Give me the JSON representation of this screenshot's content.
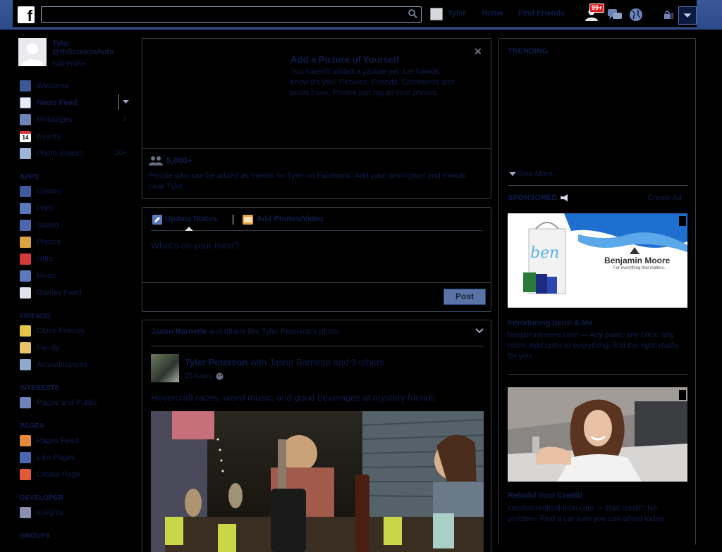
{
  "topbar": {
    "search_placeholder": "",
    "user_link": "Tyler",
    "home_link": "Home",
    "find_friends_link": "Find Friends",
    "notification_count": "99+"
  },
  "profile": {
    "name": "Tyler @fbScreenshots",
    "edit": "Edit Profile"
  },
  "nav": {
    "main": [
      {
        "label": "Welcome",
        "icon": "facebook-icon",
        "count": ""
      },
      {
        "label": "News Feed",
        "icon": "news-feed-icon",
        "count": ""
      },
      {
        "label": "Messages",
        "icon": "messages-icon",
        "count": "1"
      },
      {
        "label": "Events",
        "icon": "calendar-icon",
        "count": ""
      },
      {
        "label": "Photo Search",
        "icon": "photo-search-icon",
        "count": "20+"
      }
    ],
    "apps_heading": "APPS",
    "apps": [
      {
        "label": "Games",
        "icon": "games-icon"
      },
      {
        "label": "Polls",
        "icon": "polls-icon"
      },
      {
        "label": "Saved",
        "icon": "saved-icon"
      },
      {
        "label": "Photos",
        "icon": "photos-icon"
      },
      {
        "label": "Gifts",
        "icon": "gifts-icon"
      },
      {
        "label": "Music",
        "icon": "music-icon"
      },
      {
        "label": "Games Feed",
        "icon": "games-feed-icon"
      }
    ],
    "friends_heading": "FRIENDS",
    "friends": [
      {
        "label": "Close Friends",
        "icon": "close-friends-icon"
      },
      {
        "label": "Family",
        "icon": "family-icon"
      },
      {
        "label": "Acquaintances",
        "icon": "acquaintances-icon"
      }
    ],
    "interests_heading": "INTERESTS",
    "interests": [
      {
        "label": "Pages and Public",
        "icon": "rss-icon"
      }
    ],
    "pages_heading": "PAGES",
    "pages": [
      {
        "label": "Pages Feed",
        "icon": "pages-feed-icon"
      },
      {
        "label": "Like Pages",
        "icon": "like-pages-icon"
      },
      {
        "label": "Create Page",
        "icon": "create-page-icon"
      }
    ],
    "developer_heading": "DEVELOPER",
    "developer": [
      {
        "label": "Insights",
        "icon": "insights-icon"
      }
    ],
    "groups_heading": "GROUPS"
  },
  "add_picture": {
    "title": "Add a Picture of Yourself",
    "text": "You haven't added a picture yet. Let friends know it's you. Pictures, Friends, Comments and posts have. Photos just tag all your photos.",
    "friends_count": "5,000+",
    "friends_desc": "People who can be added as friends on Tyler on Facebook. Add your description and friends near Tyler."
  },
  "composer": {
    "tab_status": "Update Status",
    "tab_photo": "Add Photos/Video",
    "placeholder": "What's on your mind?",
    "post_label": "Post"
  },
  "story": {
    "header_name": "Jason Barnette",
    "header_rest": " and others like Tyler Peterson's photo.",
    "author": "Tyler Peterson",
    "with_text": " with Jason Barnette and 3 others",
    "time": "20 hours",
    "text": "Hovercraft races, weird music, and good beverages at mystery friends"
  },
  "right": {
    "trending_title": "TRENDING",
    "see_more": "See More",
    "sponsored_label": "SPONSORED",
    "create_ad": "Create Ad",
    "ad1": {
      "brand": "Benjamin Moore",
      "tagline": "For everything that matters.",
      "ben_text": "ben",
      "title": "Introducing ben® & Me",
      "desc": "benjaminmoore.com — Any paint, any color, any room. Add color to everything, find the right shade for you."
    },
    "ad2": {
      "title": "Rebuild Your Credit!",
      "desc": "carsforcreditsolution.com — Bad credit? No problem. Find a car loan you can afford today."
    }
  },
  "colors": {
    "topbar_blue": "#3b5998",
    "link_blue": "#0e1c4a",
    "post_button": "#5b74a8",
    "badge_red": "#e01c1c"
  }
}
